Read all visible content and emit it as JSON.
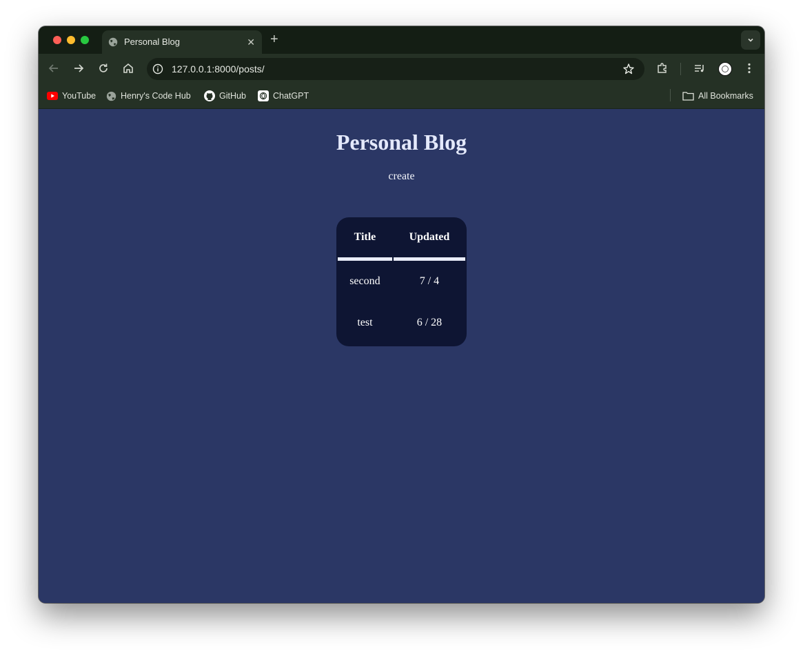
{
  "browser": {
    "tab": {
      "title": "Personal Blog"
    },
    "url": "127.0.0.1:8000/posts/",
    "bookmarks": [
      {
        "label": "YouTube",
        "icon": "youtube-icon"
      },
      {
        "label": "Henry's Code Hub",
        "icon": "globe-icon"
      },
      {
        "label": "GitHub",
        "icon": "github-icon"
      },
      {
        "label": "ChatGPT",
        "icon": "chatgpt-icon"
      }
    ],
    "all_bookmarks_label": "All Bookmarks"
  },
  "page": {
    "title": "Personal Blog",
    "create_label": "create",
    "table": {
      "headers": [
        "Title",
        "Updated"
      ],
      "rows": [
        [
          "second",
          "7 / 4"
        ],
        [
          "test",
          "6 / 28"
        ]
      ]
    }
  },
  "colors": {
    "page_background": "#2b3765",
    "card_background": "#0e1533",
    "chrome_background": "#253125"
  }
}
